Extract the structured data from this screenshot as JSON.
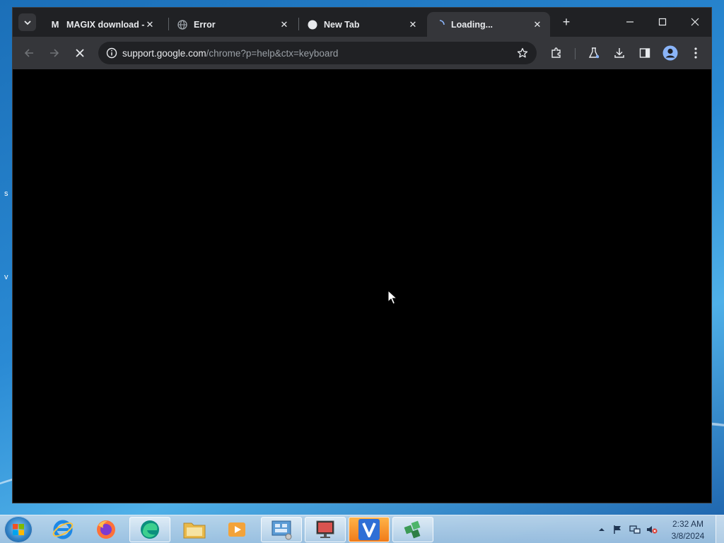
{
  "browser": {
    "tabs": [
      {
        "title": "MAGIX download - r",
        "favicon": "gmail-m-icon",
        "favicon_glyph": "M",
        "close": "✕",
        "active": false
      },
      {
        "title": "Error",
        "favicon": "globe-icon",
        "close": "✕",
        "active": false
      },
      {
        "title": "New Tab",
        "favicon": "chrome-icon",
        "close": "✕",
        "active": false
      },
      {
        "title": "Loading...",
        "favicon": "loading-icon",
        "close": "✕",
        "active": true
      }
    ],
    "new_tab_label": "+",
    "url_host": "support.google.com",
    "url_path": "/chrome?p=help&ctx=keyboard",
    "colors": {
      "frame": "#202124",
      "toolbar": "#35363a",
      "text": "#e8eaed",
      "content": "#000000"
    }
  },
  "taskbar": {
    "apps": [
      "internet-explorer-icon",
      "firefox-icon",
      "edge-icon",
      "file-explorer-icon",
      "media-player-icon",
      "control-panel-icon",
      "presentation-app-icon",
      "v-app-icon",
      "network-app-icon"
    ],
    "clock_time": "2:32 AM",
    "clock_date": "3/8/2024"
  }
}
